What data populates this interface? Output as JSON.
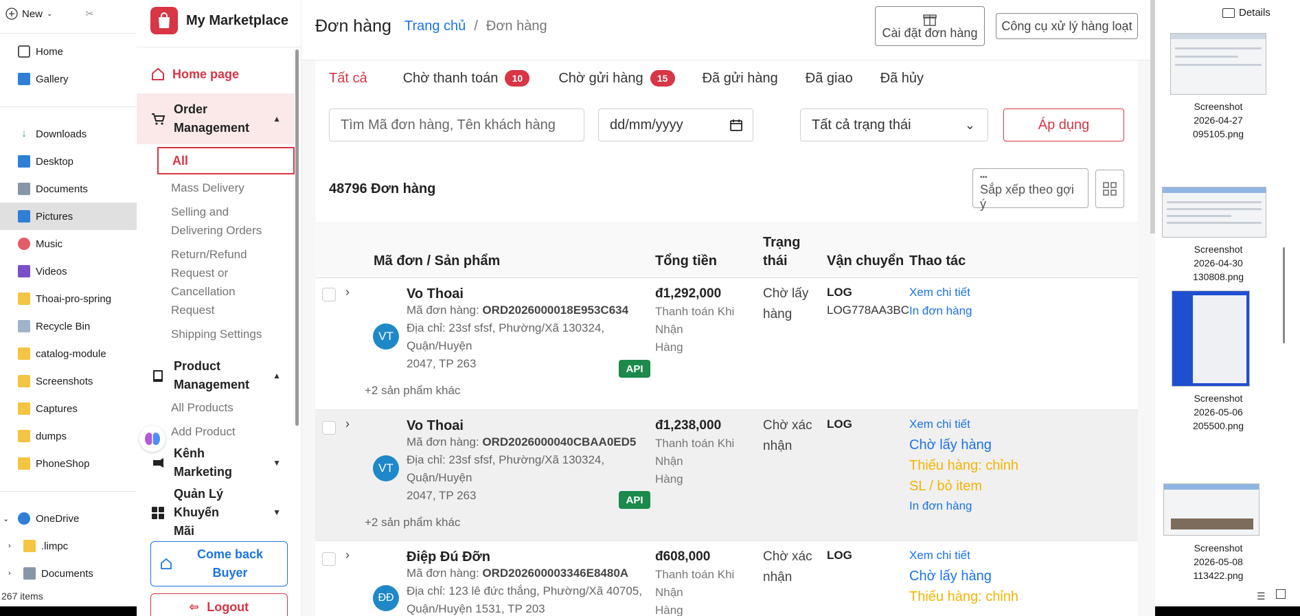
{
  "explorer": {
    "new_label": "New",
    "details_label": "Details",
    "nav": [
      {
        "label": "Home",
        "icon": "home-icon"
      },
      {
        "label": "Gallery",
        "icon": "gallery-icon"
      },
      {
        "label": "Downloads",
        "icon": "downloads-icon"
      },
      {
        "label": "Desktop",
        "icon": "desktop-icon"
      },
      {
        "label": "Documents",
        "icon": "documents-icon"
      },
      {
        "label": "Pictures",
        "icon": "pictures-icon",
        "selected": true
      },
      {
        "label": "Music",
        "icon": "music-icon"
      },
      {
        "label": "Videos",
        "icon": "videos-icon"
      },
      {
        "label": "Thoai-pro-spring",
        "icon": "folder-icon"
      },
      {
        "label": "Recycle Bin",
        "icon": "recycle-bin-icon"
      },
      {
        "label": "catalog-module",
        "icon": "folder-icon"
      },
      {
        "label": "Screenshots",
        "icon": "folder-icon"
      },
      {
        "label": "Captures",
        "icon": "folder-icon"
      },
      {
        "label": "dumps",
        "icon": "folder-icon"
      },
      {
        "label": "PhoneShop",
        "icon": "folder-icon"
      }
    ],
    "onedrive": "OneDrive",
    "limpc": ".limpc",
    "documents2": "Documents",
    "status": "267 items",
    "thumbs": [
      {
        "line1": "Screenshot",
        "line2": "2026-04-27",
        "line3": "095105.png"
      },
      {
        "line1": "Screenshot",
        "line2": "2026-04-30",
        "line3": "130808.png"
      },
      {
        "line1": "Screenshot",
        "line2": "2026-05-06",
        "line3": "205500.png"
      },
      {
        "line1": "Screenshot",
        "line2": "2026-05-08",
        "line3": "113422.png"
      }
    ]
  },
  "brand": {
    "name": "My Marketplace",
    "color": "#d83545"
  },
  "sidebar": {
    "home": "Home page",
    "order_group_line1": "Order",
    "order_group_line2": "Management",
    "sub_all": "All",
    "sub_mass": "Mass Delivery",
    "sub_selling_1": "Selling and",
    "sub_selling_2": "Delivering Orders",
    "sub_return_1": "Return/Refund",
    "sub_return_2": "Request or",
    "sub_return_3": "Cancellation",
    "sub_return_4": "Request",
    "sub_shipping": "Shipping Settings",
    "product_group_line1": "Product",
    "product_group_line2": "Management",
    "sub_all_products": "All Products",
    "sub_add_product": "Add Product",
    "marketing": "Kênh Marketing",
    "promo_line1": "Quản Lý Khuyến",
    "promo_line2": "Mãi",
    "come_back_1": "Come back",
    "come_back_2": "Buyer",
    "logout": "Logout"
  },
  "header": {
    "title": "Đơn hàng",
    "crumb_home": "Trang chủ",
    "crumb_sep": "/",
    "crumb_current": "Đơn hàng",
    "settings_btn": "Cài đặt đơn hàng",
    "bulk_btn": "Công cụ xử lý hàng loạt"
  },
  "tabs": [
    {
      "label": "Tất cả",
      "active": true
    },
    {
      "label": "Chờ thanh toán",
      "badge": "10"
    },
    {
      "label": "Chờ gửi hàng",
      "badge": "15"
    },
    {
      "label": "Đã gửi hàng"
    },
    {
      "label": "Đã giao"
    },
    {
      "label": "Đã hủy"
    }
  ],
  "filters": {
    "search_placeholder": "Tìm Mã đơn hàng, Tên khách hàng",
    "date_placeholder": "dd/mm/yyyy",
    "status_select": "Tất cả trạng thái",
    "apply": "Áp dụng"
  },
  "summary": {
    "count": "48796 Đơn hàng",
    "sort_label": "Sắp xếp theo gợi ý",
    "sort_dots": "•••"
  },
  "table": {
    "col_order": "Mã đơn / Sản phẩm",
    "col_total": "Tổng tiền",
    "col_status_1": "Trạng",
    "col_status_2": "thái",
    "col_shipping": "Vận chuyển",
    "col_actions": "Thao tác",
    "rows": [
      {
        "avatar": "VT",
        "name": "Vo Thoai",
        "order_label": "Mã đơn hàng: ",
        "order_code": "ORD2026000018E953C634",
        "address_1": "Địa chỉ: 23sf sfsf, Phường/Xã 130324, Quận/Huyện",
        "address_2": "2047, TP 263",
        "api": "API",
        "more": "+2 sản phẩm khác",
        "amount": "đ1,292,000",
        "pay_1": "Thanh toán Khi Nhận",
        "pay_2": "Hàng",
        "status_1": "Chờ lấy",
        "status_2": "hàng",
        "ship_code": "LOG",
        "ship_num": "LOG778AA3BC",
        "act_view": "Xem chi tiết",
        "act_print": "In đơn hàng"
      },
      {
        "avatar": "VT",
        "name": "Vo Thoai",
        "order_label": "Mã đơn hàng: ",
        "order_code": "ORD2026000040CBAA0ED5",
        "address_1": "Địa chỉ: 23sf sfsf, Phường/Xã 130324, Quận/Huyện",
        "address_2": "2047, TP 263",
        "api": "API",
        "more": "+2 sản phẩm khác",
        "amount": "đ1,238,000",
        "pay_1": "Thanh toán Khi Nhận",
        "pay_2": "Hàng",
        "status_1": "Chờ xác",
        "status_2": "nhận",
        "ship_code": "LOG",
        "act_view": "Xem chi tiết",
        "act_wait": "Chờ lấy hàng",
        "act_warn_1": "Thiếu hàng: chỉnh",
        "act_warn_2": "SL / bỏ item",
        "act_print": "In đơn hàng"
      },
      {
        "avatar": "ĐĐ",
        "name": "Điệp Đú Đỡn",
        "order_label": "Mã đơn hàng: ",
        "order_code": "ORD202600003346E8480A",
        "address_1": "Địa chỉ: 123 lê đức thắng, Phường/Xã 40705,",
        "address_2": "Quận/Huyện 1531, TP 203",
        "amount": "đ608,000",
        "pay_1": "Thanh toán Khi Nhận",
        "pay_2": "Hàng",
        "status_1": "Chờ xác",
        "status_2": "nhận",
        "ship_code": "LOG",
        "act_view": "Xem chi tiết",
        "act_wait": "Chờ lấy hàng",
        "act_warn_1": "Thiếu hàng: chỉnh"
      }
    ]
  },
  "colors": {
    "accent": "#d83545",
    "link": "#1a73e8",
    "api": "#1b8a4c",
    "warning": "#f5b400",
    "avatar": "#1e88c8"
  }
}
